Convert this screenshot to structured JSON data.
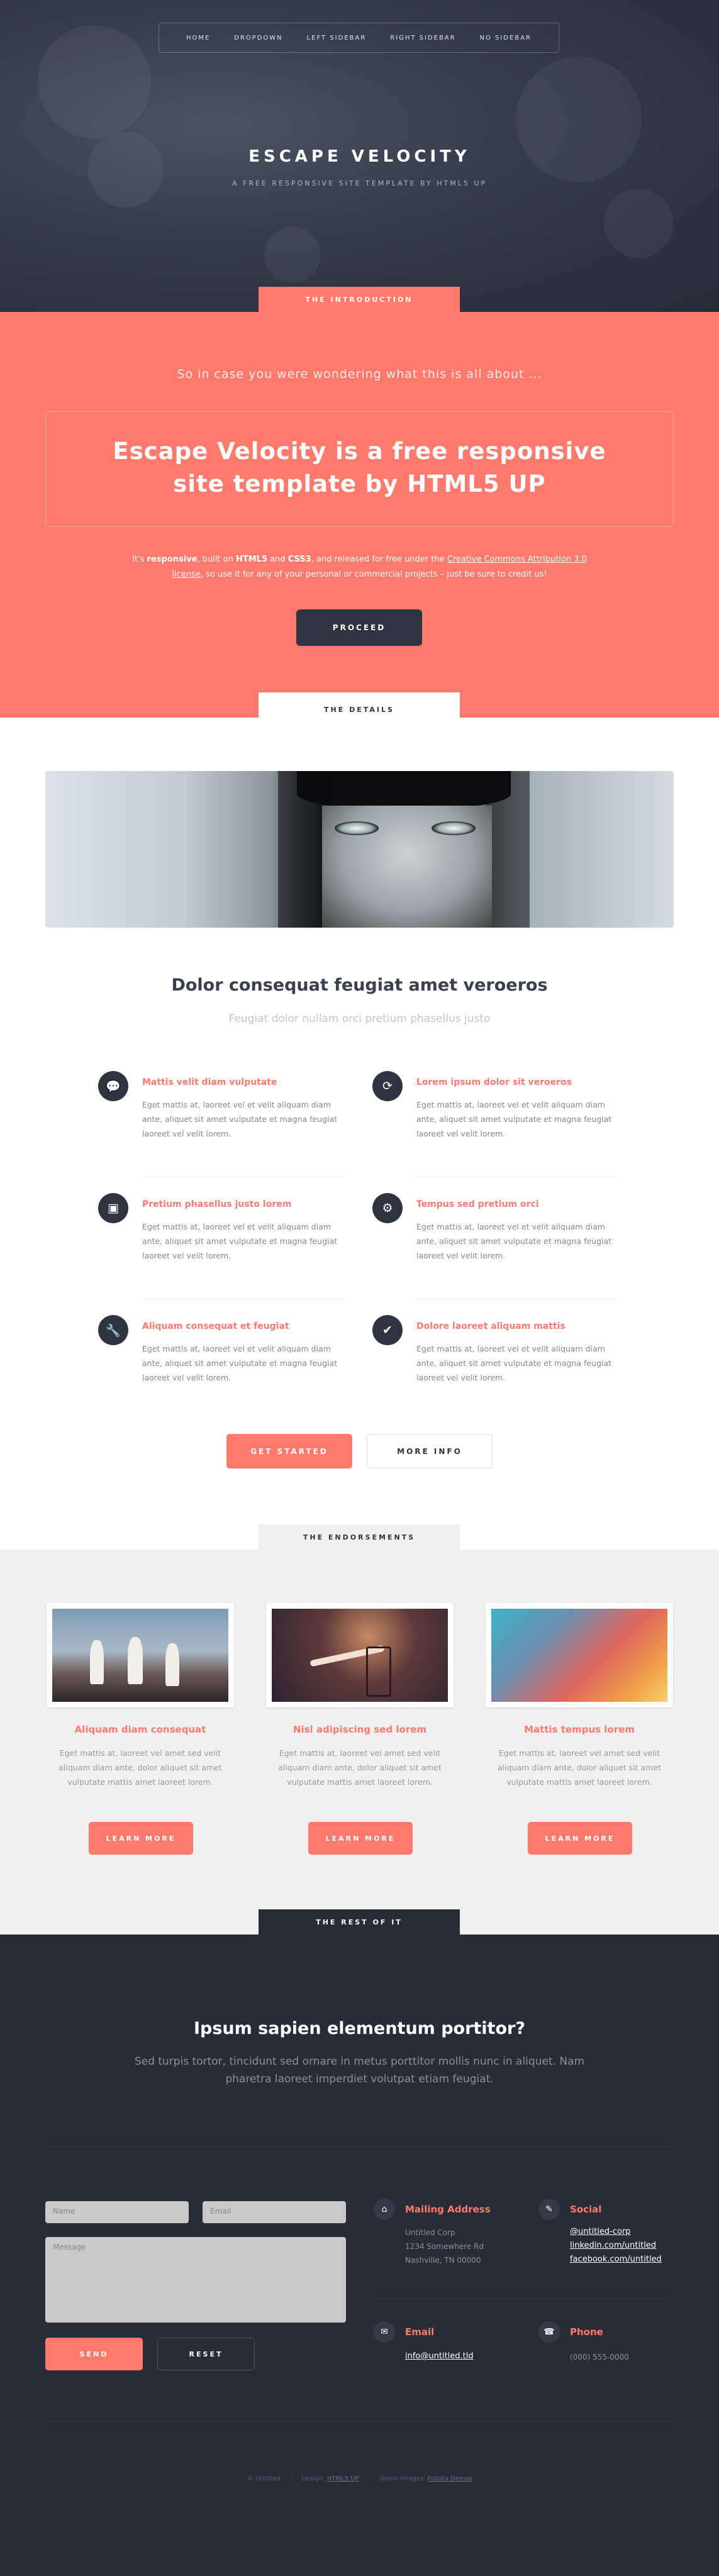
{
  "nav": {
    "items": [
      "HOME",
      "DROPDOWN",
      "LEFT SIDEBAR",
      "RIGHT SIDEBAR",
      "NO SIDEBAR"
    ]
  },
  "header": {
    "logo": "ESCAPE VELOCITY",
    "tagline": "A FREE RESPONSIVE SITE TEMPLATE BY HTML5 UP"
  },
  "intro": {
    "tab": "THE INTRODUCTION",
    "lead": "So in case you were wondering what this is all about ...",
    "title": "Escape Velocity is a free responsive site template by HTML5 UP",
    "text_1": "It's ",
    "text_bold_1": "responsive",
    "text_2": ", built on ",
    "text_bold_2": "HTML5",
    "text_3": " and ",
    "text_bold_3": "CSS3",
    "text_4": ", and released for free under the ",
    "text_link": "Creative Commons Attribution 3.0 license",
    "text_5": ", so use it for any of your personal or commercial projects – just be sure to credit us!",
    "proceed_label": "PROCEED"
  },
  "details": {
    "tab": "THE DETAILS",
    "title": "Dolor consequat feugiat amet veroeros",
    "subtitle": "Feugiat dolor nullam orci pretium phasellus justo",
    "features": [
      {
        "icon": "comment-icon",
        "glyph": "💬",
        "title": "Mattis velit diam vulputate",
        "text": "Eget mattis at, laoreet vel et velit aliquam diam ante, aliquet sit amet vulputate et magna feugiat laoreet vel velit lorem."
      },
      {
        "icon": "refresh-icon",
        "glyph": "⟳",
        "title": "Lorem ipsum dolor sit veroeros",
        "text": "Eget mattis at, laoreet vel et velit aliquam diam ante, aliquet sit amet vulputate et magna feugiat laoreet vel velit lorem."
      },
      {
        "icon": "image-icon",
        "glyph": "▣",
        "title": "Pretium phasellus justo lorem",
        "text": "Eget mattis at, laoreet vel et velit aliquam diam ante, aliquet sit amet vulputate et magna feugiat laoreet vel velit lorem."
      },
      {
        "icon": "gear-icon",
        "glyph": "⚙",
        "title": "Tempus sed pretium orci",
        "text": "Eget mattis at, laoreet vel et velit aliquam diam ante, aliquet sit amet vulputate et magna feugiat laoreet vel velit lorem."
      },
      {
        "icon": "wrench-icon",
        "glyph": "🔧",
        "title": "Aliquam consequat et feugiat",
        "text": "Eget mattis at, laoreet vel et velit aliquam diam ante, aliquet sit amet vulputate et magna feugiat laoreet vel velit lorem."
      },
      {
        "icon": "check-icon",
        "glyph": "✔",
        "title": "Dolore laoreet aliquam mattis",
        "text": "Eget mattis at, laoreet vel et velit aliquam diam ante, aliquet sit amet vulputate et magna feugiat laoreet vel velit lorem."
      }
    ],
    "get_started_label": "GET STARTED",
    "more_info_label": "MORE INFO"
  },
  "endorsements": {
    "tab": "THE ENDORSEMENTS",
    "cards": [
      {
        "title": "Aliquam diam consequat",
        "text": "Eget mattis at, laoreet vel amet sed velit aliquam diam ante, dolor aliquet sit amet vulputate mattis amet laoreet lorem.",
        "button": "LEARN MORE"
      },
      {
        "title": "Nisl adipiscing sed lorem",
        "text": "Eget mattis at, laoreet vel amet sed velit aliquam diam ante, dolor aliquet sit amet vulputate mattis amet laoreet lorem.",
        "button": "LEARN MORE"
      },
      {
        "title": "Mattis tempus lorem",
        "text": "Eget mattis at, laoreet vel amet sed velit aliquam diam ante, dolor aliquet sit amet vulputate mattis amet laoreet lorem.",
        "button": "LEARN MORE"
      }
    ]
  },
  "footer": {
    "tab": "THE REST OF IT",
    "title": "Ipsum sapien elementum portitor?",
    "subtitle": "Sed turpis tortor, tincidunt sed ornare in metus porttitor mollis nunc in aliquet. Nam pharetra laoreet imperdiet volutpat etiam feugiat.",
    "form": {
      "name_placeholder": "Name",
      "email_placeholder": "Email",
      "message_placeholder": "Message",
      "send_label": "SEND",
      "reset_label": "RESET"
    },
    "mailing": {
      "heading": "Mailing Address",
      "line1": "Untitled Corp",
      "line2": "1234 Somewhere Rd",
      "line3": "Nashville, TN 00000"
    },
    "social": {
      "heading": "Social",
      "links": [
        "@untitled-corp",
        "linkedin.com/untitled",
        "facebook.com/untitled"
      ]
    },
    "email": {
      "heading": "Email",
      "link": "info@untitled.tld"
    },
    "phone": {
      "heading": "Phone",
      "number": "(000) 555-0000"
    },
    "copyright": {
      "owner": "© Untitled",
      "design_prefix": "Design: ",
      "design_link": "HTML5 UP",
      "images_prefix": "Demo Images: ",
      "images_link": "Fotolia Demos"
    }
  }
}
